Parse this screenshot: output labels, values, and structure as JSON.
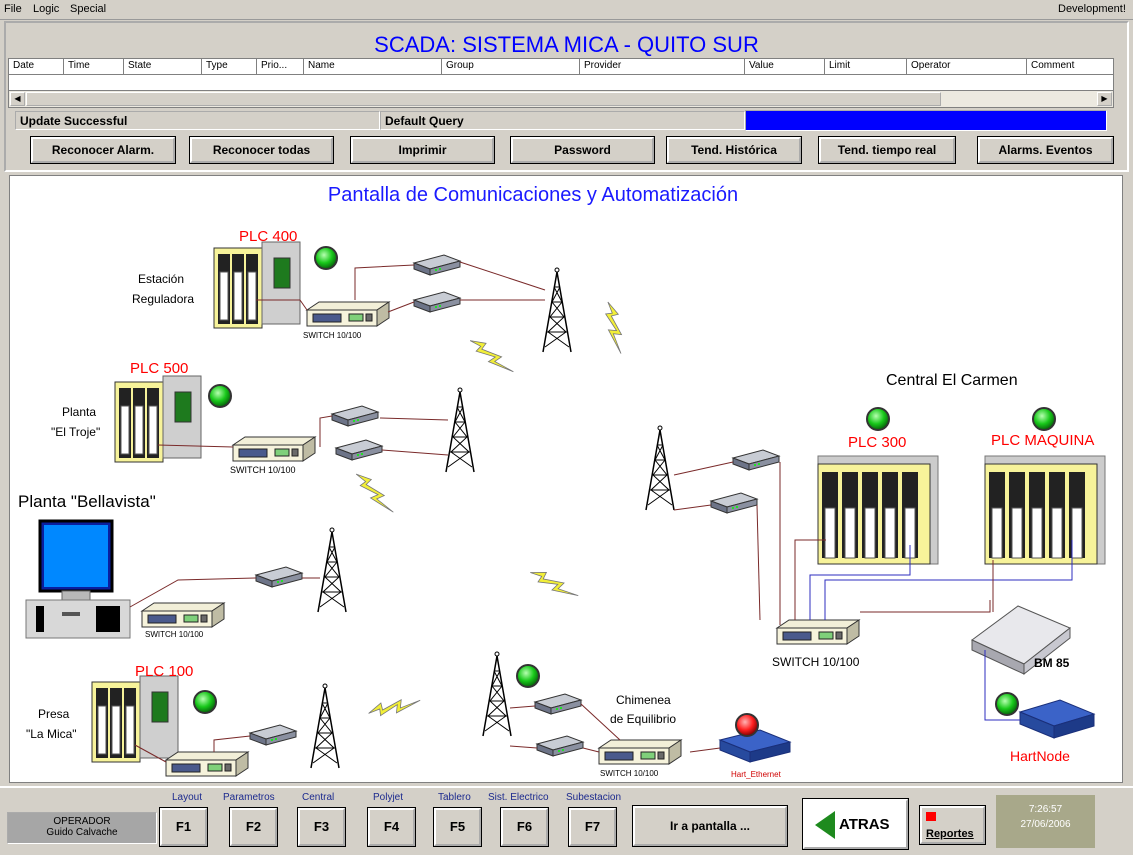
{
  "menu": {
    "items": [
      "File",
      "Logic",
      "Special"
    ],
    "right": "Development!"
  },
  "header": {
    "title": "SCADA: SISTEMA MICA - QUITO SUR",
    "columns": [
      "Date",
      "Time",
      "State",
      "Type",
      "Prio...",
      "Name",
      "Group",
      "Provider",
      "Value",
      "Limit",
      "Operator",
      "Comment"
    ],
    "status_left": "Update Successful",
    "status_query": "Default Query"
  },
  "toolbar": {
    "buttons": [
      "Reconocer Alarm.",
      "Reconocer todas",
      "Imprimir",
      "Password",
      "Tend. Histórica",
      "Tend. tiempo real",
      "Alarms. Eventos"
    ]
  },
  "diagram": {
    "title": "Pantalla de Comunicaciones y Automatización",
    "plc400": "PLC 400",
    "estacion": [
      "Estación",
      "Reguladora"
    ],
    "switch_a": "SWITCH 10/100",
    "plc500": "PLC 500",
    "planta_troje": [
      "Planta",
      "\"El Troje\""
    ],
    "switch_b": "SWITCH 10/100",
    "bellavista": "Planta \"Bellavista\"",
    "switch_c": "SWITCH 10/100",
    "plc100": "PLC 100",
    "presa": [
      "Presa",
      "\"La Mica\""
    ],
    "central": "Central El Carmen",
    "plc300": "PLC 300",
    "plc_maquina": "PLC MAQUINA",
    "switch_main": "SWITCH 10/100",
    "bm85": "BM 85",
    "hartnode": "HartNode",
    "chimenea": [
      "Chimenea",
      "de Equilibrio"
    ],
    "switch_d": "SWITCH 10/100",
    "hart_ethernet": "Hart_Ethernet"
  },
  "bottom": {
    "operator_label": "OPERADOR",
    "operator_name": "Guido Calvache",
    "fkeys": [
      {
        "caption": "Layout",
        "key": "F1"
      },
      {
        "caption": "Parametros",
        "key": "F2"
      },
      {
        "caption": "Central",
        "key": "F3"
      },
      {
        "caption": "Polyjet",
        "key": "F4"
      },
      {
        "caption": "Tablero",
        "key": "F5"
      },
      {
        "caption": "Sist. Electrico",
        "key": "F6"
      },
      {
        "caption": "Subestacion",
        "key": "F7"
      }
    ],
    "goto": "Ir a pantalla ...",
    "back": "ATRAS",
    "reports": "Reportes",
    "time": "7:26:57",
    "date": "27/06/2006"
  },
  "colors": {
    "accent_blue": "#0000ff",
    "plc_red": "#ff0000",
    "led_green": "#18c81a",
    "panel": "#d4d0c8"
  }
}
